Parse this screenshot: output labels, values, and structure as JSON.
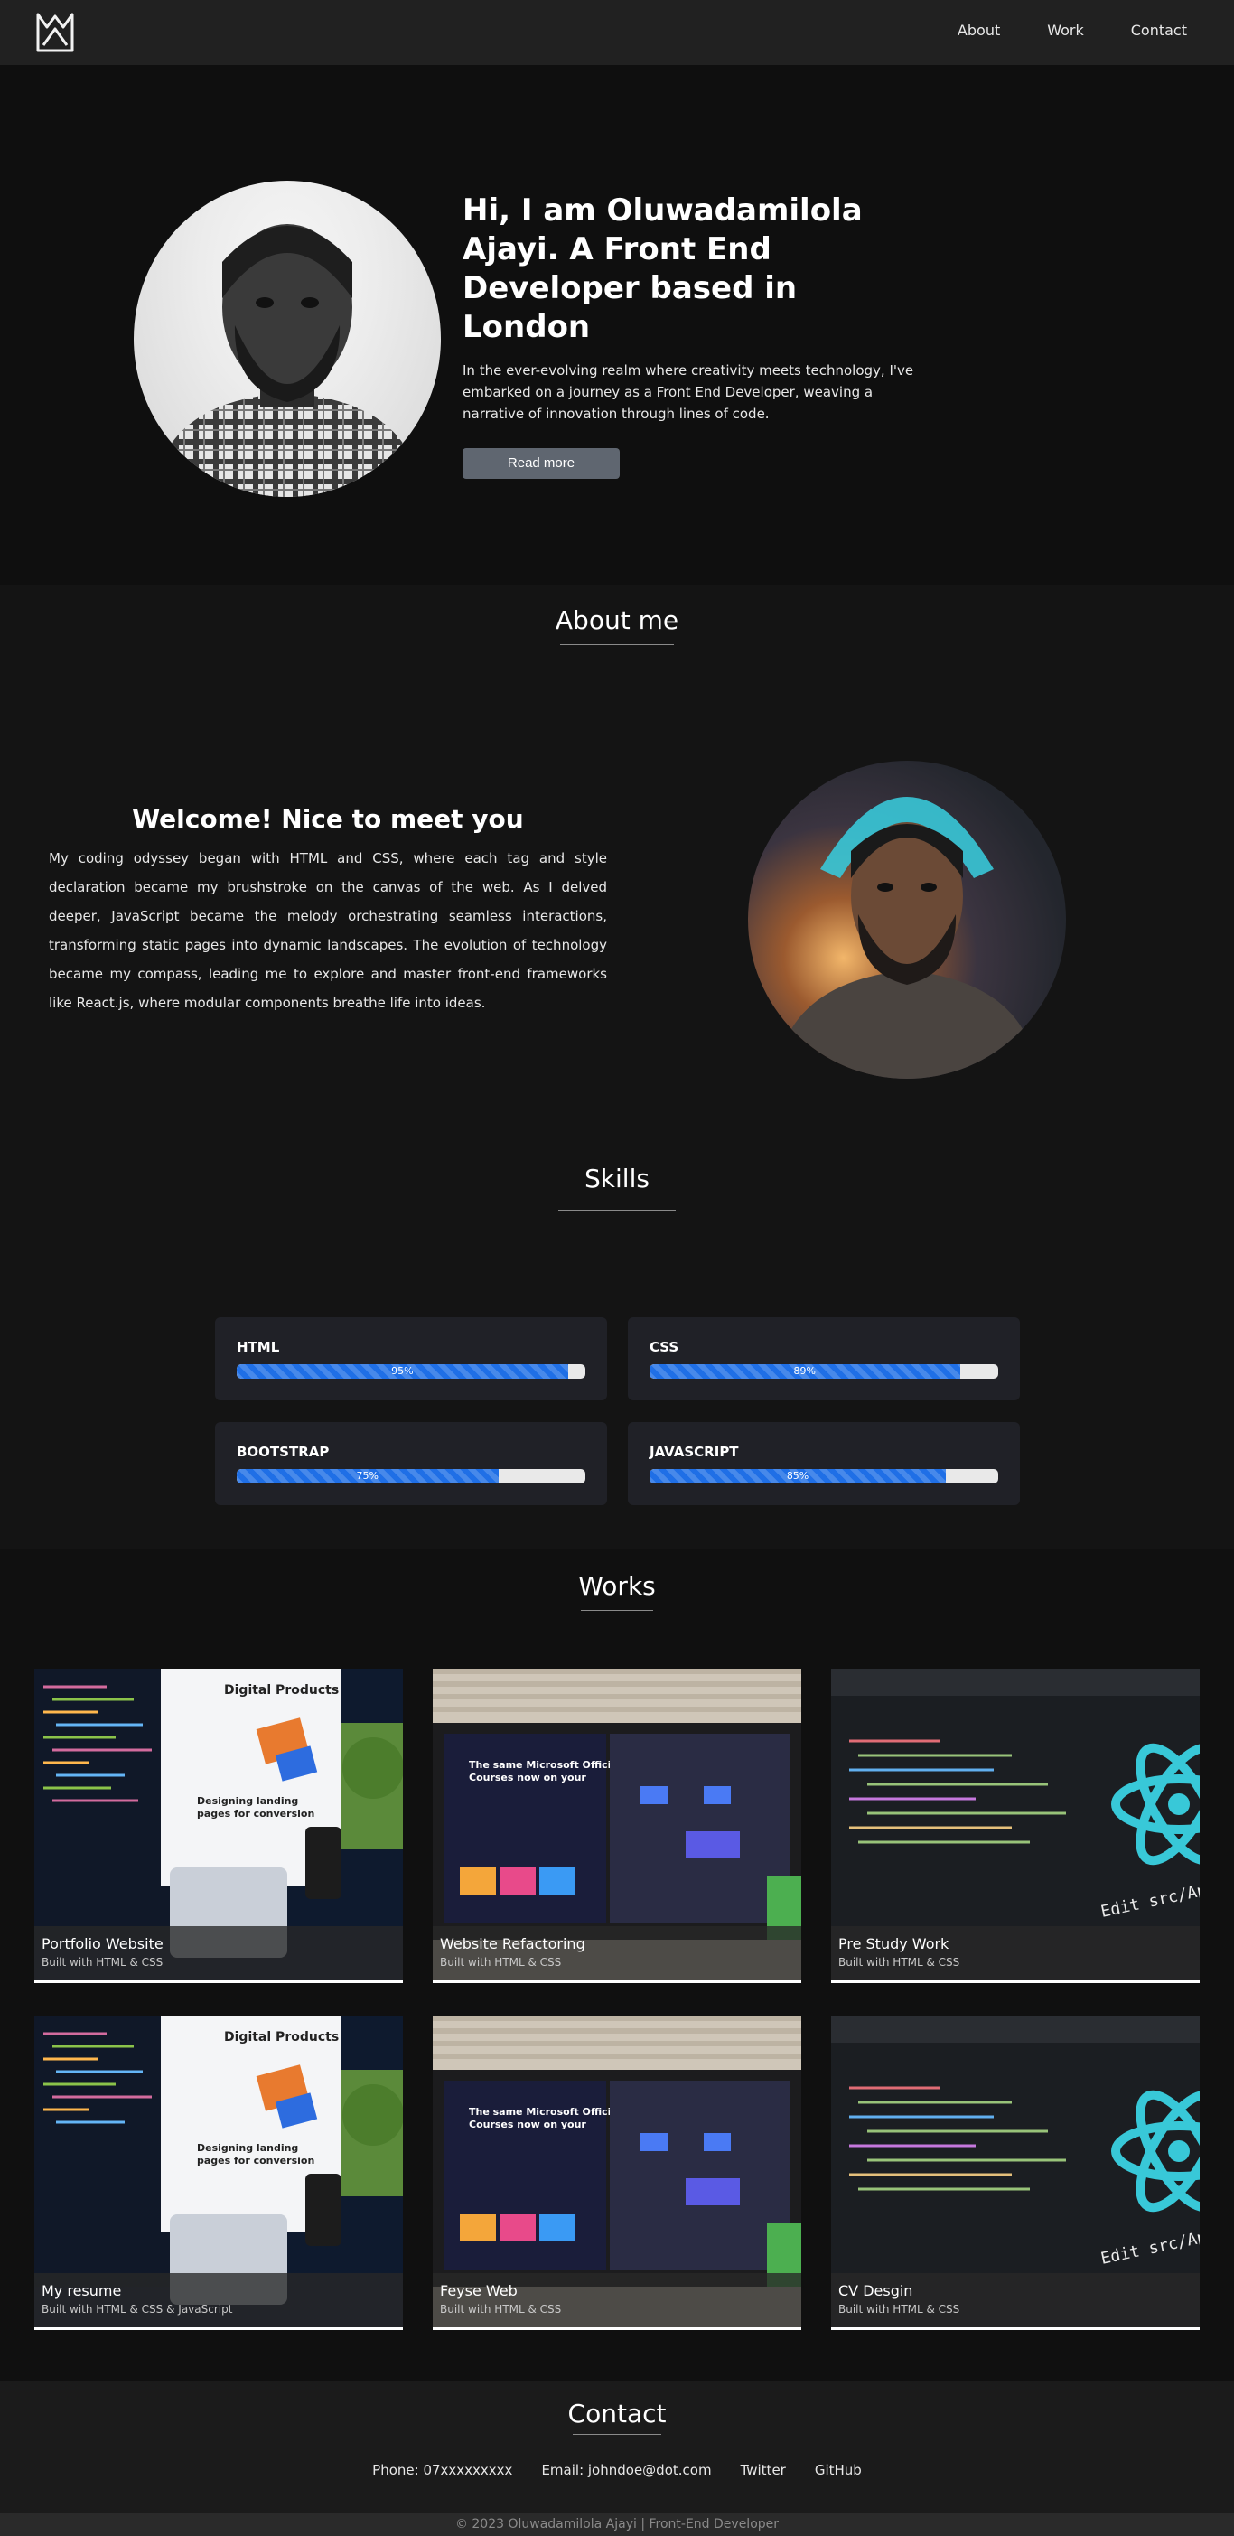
{
  "nav": {
    "links": [
      "About",
      "Work",
      "Contact"
    ]
  },
  "hero": {
    "title": "Hi, I am Oluwadamilola Ajayi. A Front End Developer based in London",
    "description": "In the ever-evolving realm where creativity meets technology, I've embarked on a journey as a Front End Developer, weaving a narrative of innovation through lines of code.",
    "button": "Read more"
  },
  "about": {
    "title": "About me",
    "welcome": "Welcome! Nice to meet you",
    "body": "My coding odyssey began with HTML and CSS, where each tag and style declaration became my brushstroke on the canvas of the web. As I delved deeper, JavaScript became the melody orchestrating seamless interactions, transforming static pages into dynamic landscapes. The evolution of technology became my compass, leading me to explore and master front-end frameworks like React.js, where modular components breathe life into ideas."
  },
  "skills": {
    "title": "Skills",
    "items": [
      {
        "name": "HTML",
        "label": "95%",
        "value": 0.95
      },
      {
        "name": "CSS",
        "label": "89%",
        "value": 0.89
      },
      {
        "name": "BOOTSTRAP",
        "label": "75%",
        "value": 0.75
      },
      {
        "name": "JAVASCRIPT",
        "label": "85%",
        "value": 0.85
      }
    ]
  },
  "works": {
    "title": "Works",
    "items": [
      {
        "name": "Portfolio Website",
        "sub": "Built with HTML & CSS",
        "image": "laptop-digital-products"
      },
      {
        "name": "Website Refactoring",
        "sub": "Built with HTML & CSS",
        "image": "monitor-editor"
      },
      {
        "name": "Pre Study Work",
        "sub": "Built with HTML & CSS",
        "image": "react-code-screen"
      },
      {
        "name": "My resume",
        "sub": "Built with HTML & CSS & JavaScript",
        "image": "laptop-digital-products"
      },
      {
        "name": "Feyse Web",
        "sub": "Built with HTML & CSS",
        "image": "monitor-editor"
      },
      {
        "name": "CV Desgin",
        "sub": "Built with HTML & CSS",
        "image": "react-code-screen"
      }
    ]
  },
  "contact": {
    "title": "Contact",
    "phone": "Phone: 07xxxxxxxxx",
    "email": "Email: johndoe@dot.com",
    "twitter": "Twitter",
    "github": "GitHub"
  },
  "footer": {
    "text": "© 2023 Oluwadamilola Ajayi | Front-End Developer"
  },
  "colors": {
    "bar": "#1f6fe6",
    "accent_cyan": "#38c8d8"
  }
}
